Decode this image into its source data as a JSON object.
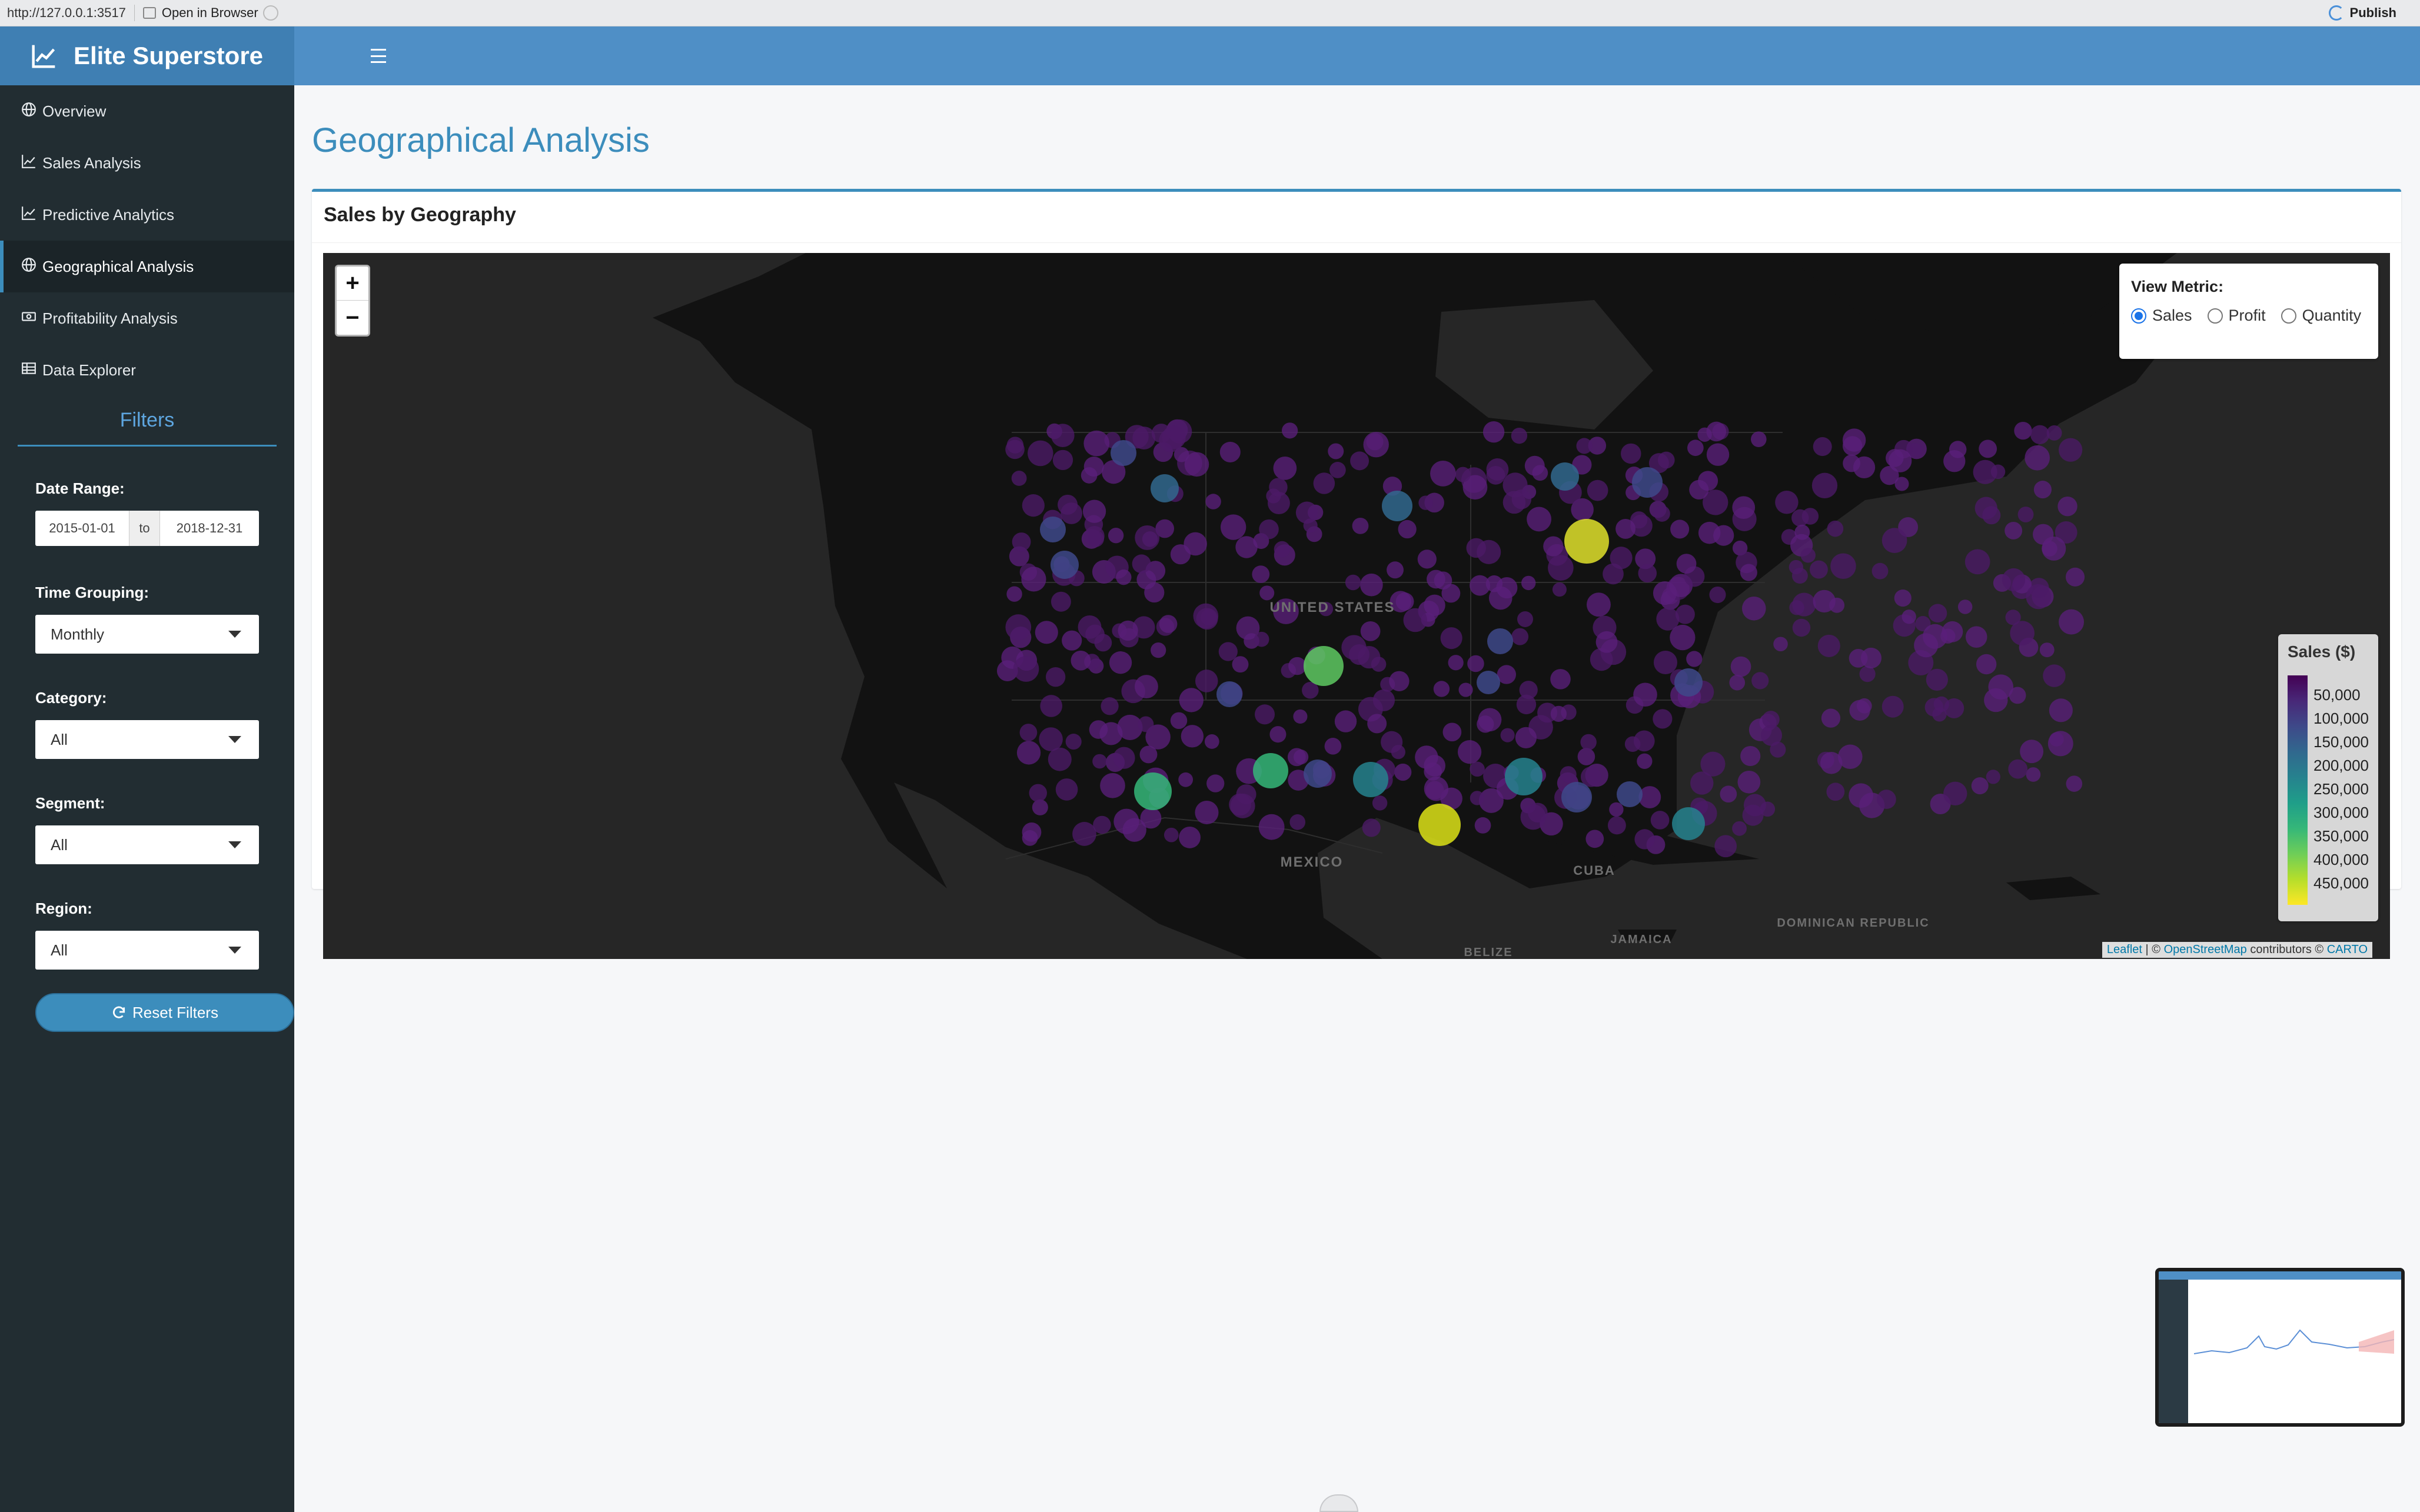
{
  "browser": {
    "url": "http://127.0.0.1:3517",
    "open_in_browser": "Open in Browser",
    "publish": "Publish"
  },
  "app": {
    "title": "Elite Superstore"
  },
  "sidebar": {
    "items": [
      {
        "label": "Overview",
        "icon": "globe-icon",
        "active": false
      },
      {
        "label": "Sales Analysis",
        "icon": "line-chart-icon",
        "active": false
      },
      {
        "label": "Predictive Analytics",
        "icon": "line-chart-icon",
        "active": false
      },
      {
        "label": "Geographical Analysis",
        "icon": "globe-icon",
        "active": true
      },
      {
        "label": "Profitability Analysis",
        "icon": "money-icon",
        "active": false
      },
      {
        "label": "Data Explorer",
        "icon": "table-icon",
        "active": false
      }
    ],
    "filters_title": "Filters",
    "date_range": {
      "label": "Date Range:",
      "start": "2015-01-01",
      "separator": "to",
      "end": "2018-12-31"
    },
    "time_grouping": {
      "label": "Time Grouping:",
      "value": "Monthly"
    },
    "category": {
      "label": "Category:",
      "value": "All"
    },
    "segment": {
      "label": "Segment:",
      "value": "All"
    },
    "region": {
      "label": "Region:",
      "value": "All"
    },
    "reset_button": "Reset Filters"
  },
  "main": {
    "page_title": "Geographical Analysis",
    "box_title": "Sales by Geography",
    "map": {
      "zoom_in": "+",
      "zoom_out": "−",
      "place_labels": [
        {
          "text": "UNITED STATES"
        },
        {
          "text": "MEXICO"
        },
        {
          "text": "CUBA"
        },
        {
          "text": "JAMAICA"
        },
        {
          "text": "DOMINICAN REPUBLIC"
        },
        {
          "text": "BELIZE"
        }
      ],
      "metric_panel": {
        "title": "View Metric:",
        "options": [
          {
            "label": "Sales",
            "checked": true
          },
          {
            "label": "Profit",
            "checked": false
          },
          {
            "label": "Quantity",
            "checked": false
          }
        ]
      },
      "legend": {
        "title": "Sales ($)",
        "ticks": [
          "50,000",
          "100,000",
          "150,000",
          "200,000",
          "250,000",
          "300,000",
          "350,000",
          "400,000",
          "450,000"
        ],
        "colors": [
          "#440154",
          "#482878",
          "#3e4989",
          "#31688e",
          "#26828e",
          "#1f9e89",
          "#35b779",
          "#6ece58",
          "#b5de2b",
          "#fde725"
        ]
      },
      "attribution": {
        "leaflet": "Leaflet",
        "separator": "| ©",
        "osm": "OpenStreetMap",
        "contributors": "contributors ©",
        "carto": "CARTO"
      }
    }
  },
  "colors": {
    "header": "#4f8fc6",
    "brand": "#3f7fb3",
    "sidebar": "#222d32",
    "accent": "#3c8dbc",
    "map_bg": "#262626"
  }
}
